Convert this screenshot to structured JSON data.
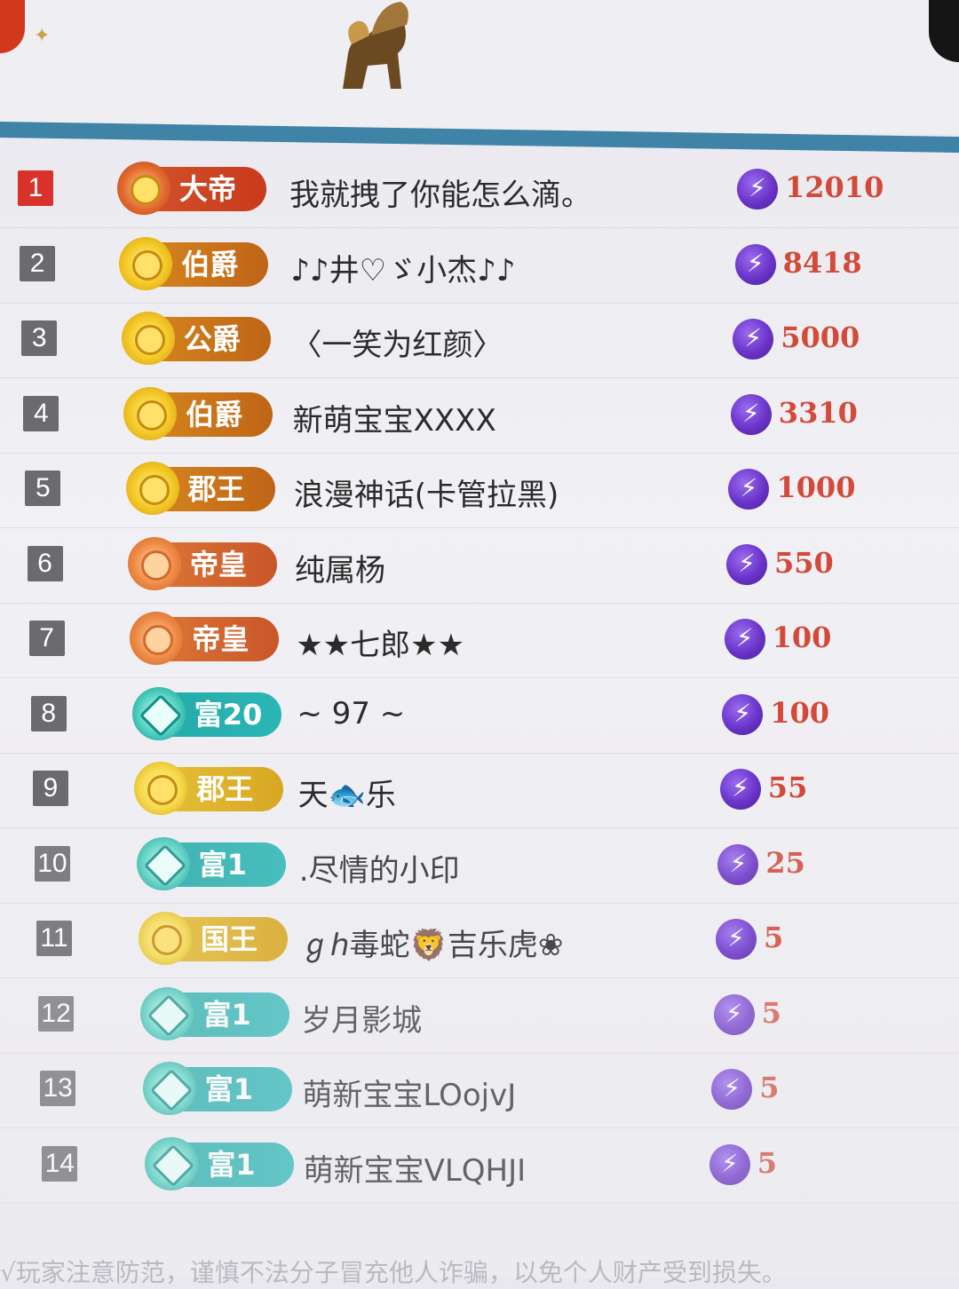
{
  "colors": {
    "accent_blue": "#3f83a7",
    "score_red": "#d24a3a",
    "rank_first": "#d8322a",
    "rank_default": "#6b6b6f",
    "coin_purple": "#6a34c9"
  },
  "header": {
    "mascot_icon": "winged-lion-icon",
    "corner_icon": "sparkle-icon"
  },
  "leaderboard": {
    "coin_icon": "lightning-coin-icon",
    "rows": [
      {
        "rank": "1",
        "badge_label": "大帝",
        "badge_style": "red",
        "name": "我就拽了你能怎么滴。",
        "score": "12010"
      },
      {
        "rank": "2",
        "badge_label": "伯爵",
        "badge_style": "gold",
        "name": "♪♪井♡ゞ小杰♪♪",
        "score": "8418"
      },
      {
        "rank": "3",
        "badge_label": "公爵",
        "badge_style": "gold",
        "name": "〈一笑为红颜〉",
        "score": "5000"
      },
      {
        "rank": "4",
        "badge_label": "伯爵",
        "badge_style": "gold",
        "name": "新萌宝宝XXXX",
        "score": "3310"
      },
      {
        "rank": "5",
        "badge_label": "郡王",
        "badge_style": "gold",
        "name": "浪漫神话(卡管拉黑)",
        "score": "1000"
      },
      {
        "rank": "6",
        "badge_label": "帝皇",
        "badge_style": "emperor",
        "name": "纯属杨",
        "score": "550"
      },
      {
        "rank": "7",
        "badge_label": "帝皇",
        "badge_style": "emperor",
        "name": "★★七郎★★",
        "score": "100"
      },
      {
        "rank": "8",
        "badge_label": "富20",
        "badge_style": "teal",
        "name": "~ 97 ~",
        "score": "100"
      },
      {
        "rank": "9",
        "badge_label": "郡王",
        "badge_style": "gold2",
        "name": "天🐟乐",
        "score": "55"
      },
      {
        "rank": "10",
        "badge_label": "富1",
        "badge_style": "teal",
        "name": ".尽情的小印",
        "score": "25"
      },
      {
        "rank": "11",
        "badge_label": "国王",
        "badge_style": "gold2",
        "name": "ℊℎ毒蛇🦁吉乐虎❀",
        "score": "5"
      },
      {
        "rank": "12",
        "badge_label": "富1",
        "badge_style": "teal",
        "name": "岁月影城",
        "score": "5"
      },
      {
        "rank": "13",
        "badge_label": "富1",
        "badge_style": "teal",
        "name": "萌新宝宝LOojvJ",
        "score": "5"
      },
      {
        "rank": "14",
        "badge_label": "富1",
        "badge_style": "teal",
        "name": "萌新宝宝VLQHJI",
        "score": "5"
      }
    ]
  },
  "footer": {
    "notice_partial": "√玩家注意防范，谨慎不法分子冒充他人诈骗，以免个人财产受到损失。"
  }
}
